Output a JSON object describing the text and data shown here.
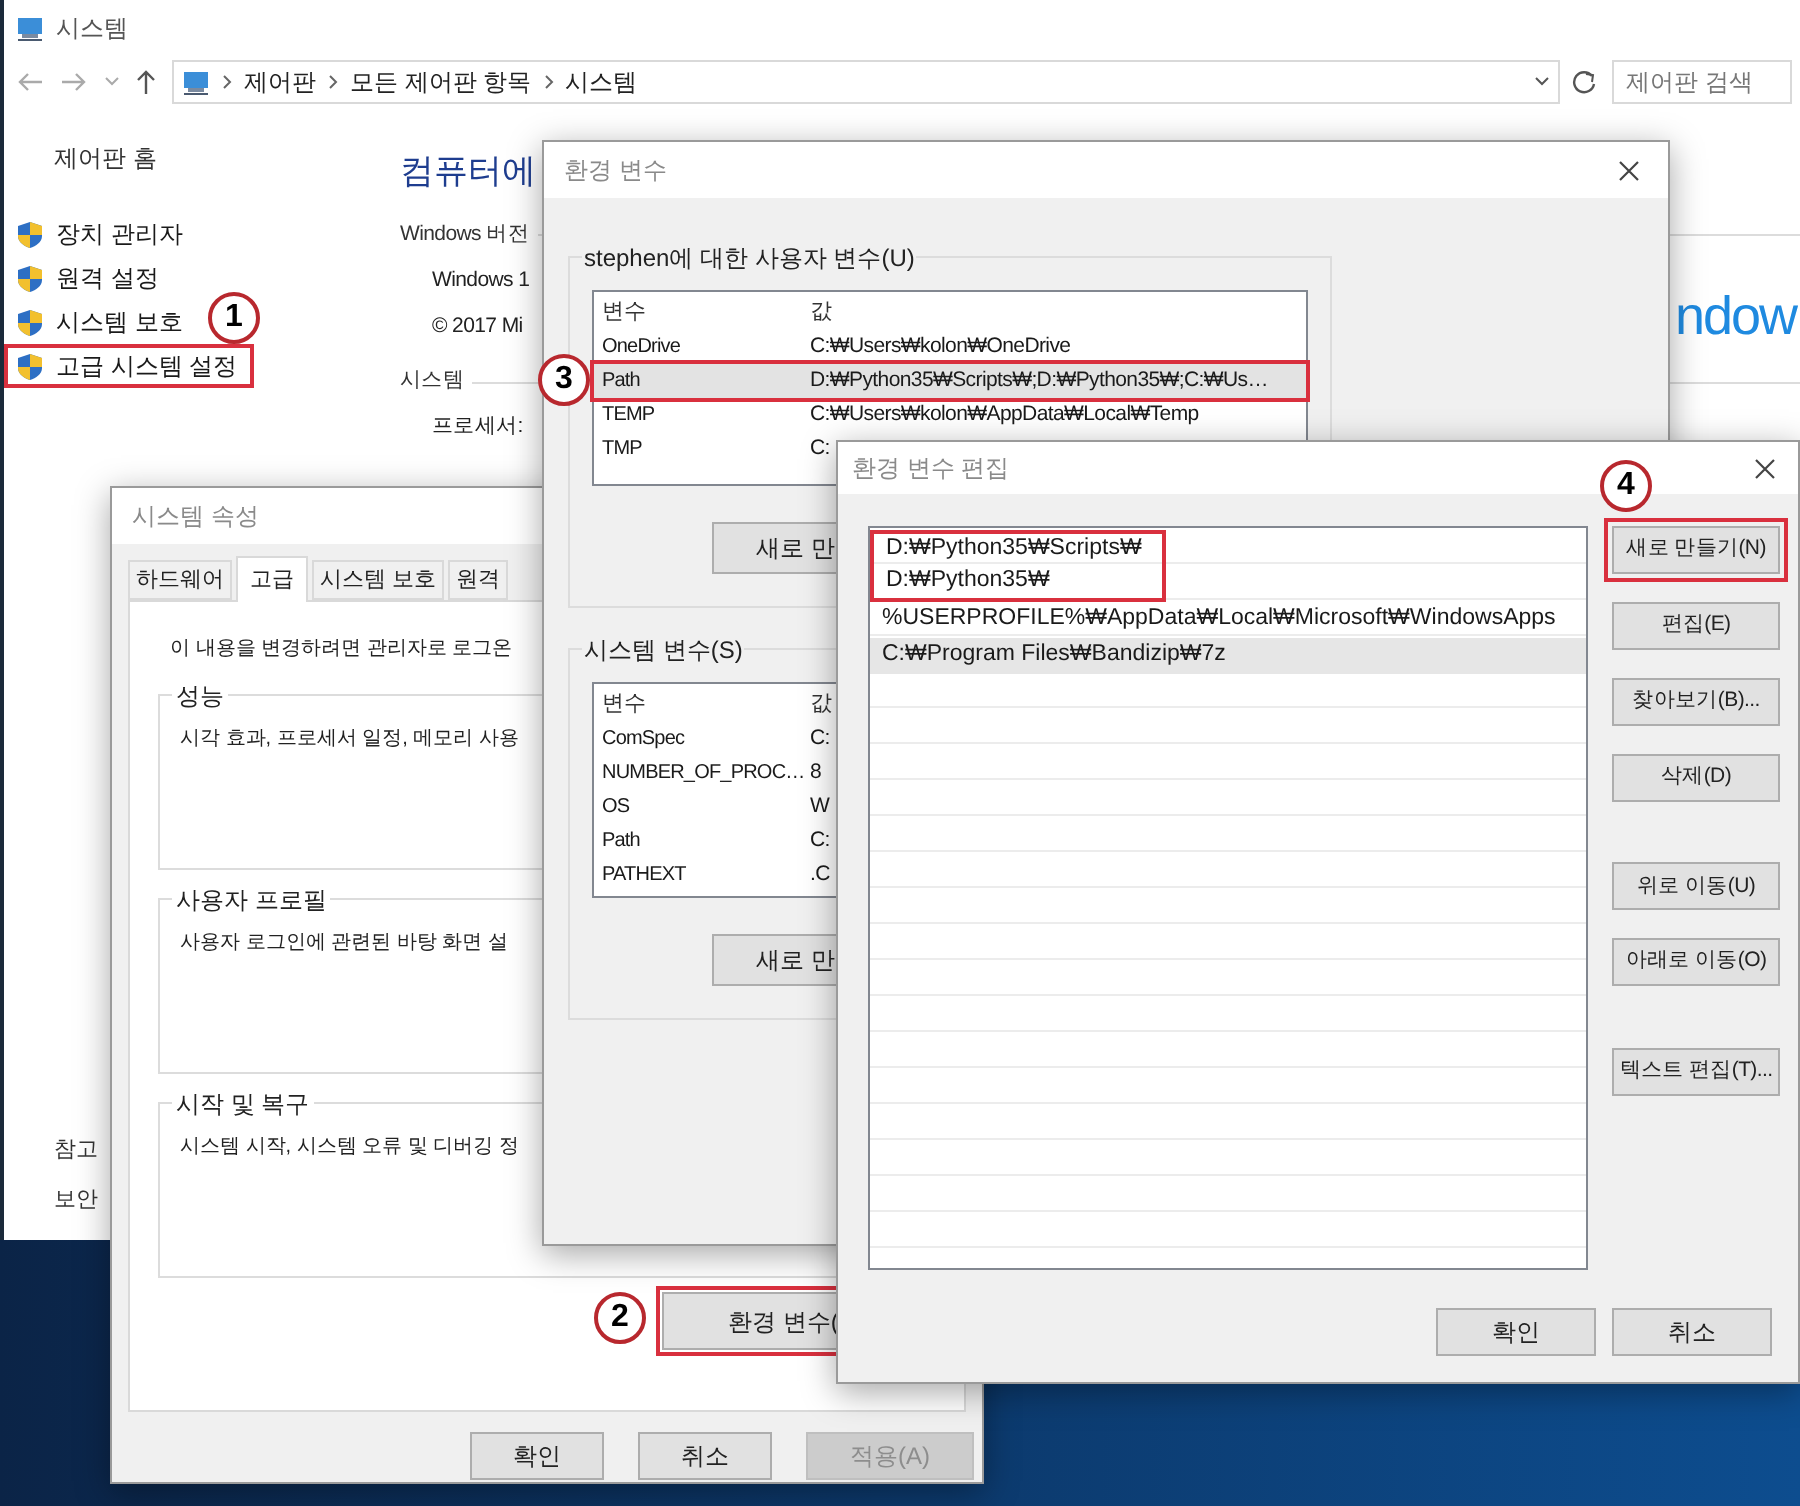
{
  "control_panel": {
    "title": "시스템",
    "breadcrumb": [
      "제어판",
      "모든 제어판 항목",
      "시스템"
    ],
    "search": {
      "placeholder": "제어판 검색"
    },
    "sidebar": {
      "home": "제어판 홈",
      "items": [
        {
          "label": "장치 관리자"
        },
        {
          "label": "원격 설정"
        },
        {
          "label": "시스템 보호"
        },
        {
          "label": "고급 시스템 설정",
          "callout": "1"
        }
      ],
      "footer": [
        "참고",
        "보안"
      ]
    },
    "heading": "컴퓨터에",
    "info": [
      {
        "kind": "section",
        "text": "Windows 버전"
      },
      {
        "kind": "value",
        "text": "Windows 1"
      },
      {
        "kind": "value",
        "text": "© 2017 Mi"
      },
      {
        "kind": "section",
        "text": "시스템"
      },
      {
        "kind": "value",
        "text": "프로세서:"
      }
    ],
    "logo_text": "ndow"
  },
  "system_properties": {
    "title": "시스템 속성",
    "tabs": [
      {
        "label": "하드웨어",
        "selected": false
      },
      {
        "label": "고급",
        "selected": true
      },
      {
        "label": "시스템 보호",
        "selected": false
      },
      {
        "label": "원격",
        "selected": false
      }
    ],
    "notice": "이 내용을 변경하려면 관리자로 로그온",
    "groups": [
      {
        "title": "성능",
        "text": "시각 효과, 프로세서 일정, 메모리 사용"
      },
      {
        "title": "사용자 프로필",
        "text": "사용자 로그인에 관련된 바탕 화면 설"
      },
      {
        "title": "시작 및 복구",
        "text": "시스템 시작, 시스템 오류 및 디버깅 정"
      }
    ],
    "env_button": {
      "label": "환경 변수(",
      "callout": "2"
    },
    "buttons": [
      {
        "label": "확인",
        "disabled": false
      },
      {
        "label": "취소",
        "disabled": false
      },
      {
        "label": "적용(A)",
        "disabled": true
      }
    ]
  },
  "environment_variables": {
    "title": "환경 변수",
    "user": {
      "title": "stephen에 대한 사용자 변수(U)",
      "columns": [
        "변수",
        "값"
      ],
      "rows": [
        {
          "name": "OneDrive",
          "value": "C:₩Users₩kolon₩OneDrive",
          "selected": false
        },
        {
          "name": "Path",
          "value": "D:₩Python35₩Scripts₩;D:₩Python35₩;C:₩Us…",
          "selected": true,
          "callout": "3"
        },
        {
          "name": "TEMP",
          "value": "C:₩Users₩kolon₩AppData₩Local₩Temp",
          "selected": false
        },
        {
          "name": "TMP",
          "value": "C:",
          "selected": false
        }
      ],
      "button": "새로 만"
    },
    "system": {
      "title": "시스템 변수(S)",
      "columns": [
        "변수",
        "값"
      ],
      "rows": [
        {
          "name": "ComSpec",
          "value": "C:",
          "selected": false
        },
        {
          "name": "NUMBER_OF_PROC…",
          "value": "8",
          "selected": false
        },
        {
          "name": "OS",
          "value": "W",
          "selected": false
        },
        {
          "name": "Path",
          "value": "C:",
          "selected": false
        },
        {
          "name": "PATHEXT",
          "value": ".C",
          "selected": false
        }
      ],
      "button": "새로 만"
    }
  },
  "edit_dialog": {
    "title": "환경 변수 편집",
    "entries": [
      {
        "text": "D:₩Python35₩Scripts₩",
        "selected": false,
        "highlighted": true
      },
      {
        "text": "D:₩Python35₩",
        "selected": false,
        "highlighted": true
      },
      {
        "text": "%USERPROFILE%₩AppData₩Local₩Microsoft₩WindowsApps",
        "selected": false,
        "highlighted": false
      },
      {
        "text": "C:₩Program Files₩Bandizip₩7z",
        "selected": true,
        "highlighted": false
      }
    ],
    "side_buttons": [
      [
        {
          "label": "새로 만들기(N)",
          "callout": "4"
        },
        {
          "label": "편집(E)"
        },
        {
          "label": "찾아보기(B)..."
        },
        {
          "label": "삭제(D)"
        }
      ],
      [
        {
          "label": "위로 이동(U)"
        },
        {
          "label": "아래로 이동(O)"
        }
      ],
      [
        {
          "label": "텍스트 편집(T)..."
        }
      ]
    ],
    "buttons": [
      "확인",
      "취소"
    ]
  }
}
